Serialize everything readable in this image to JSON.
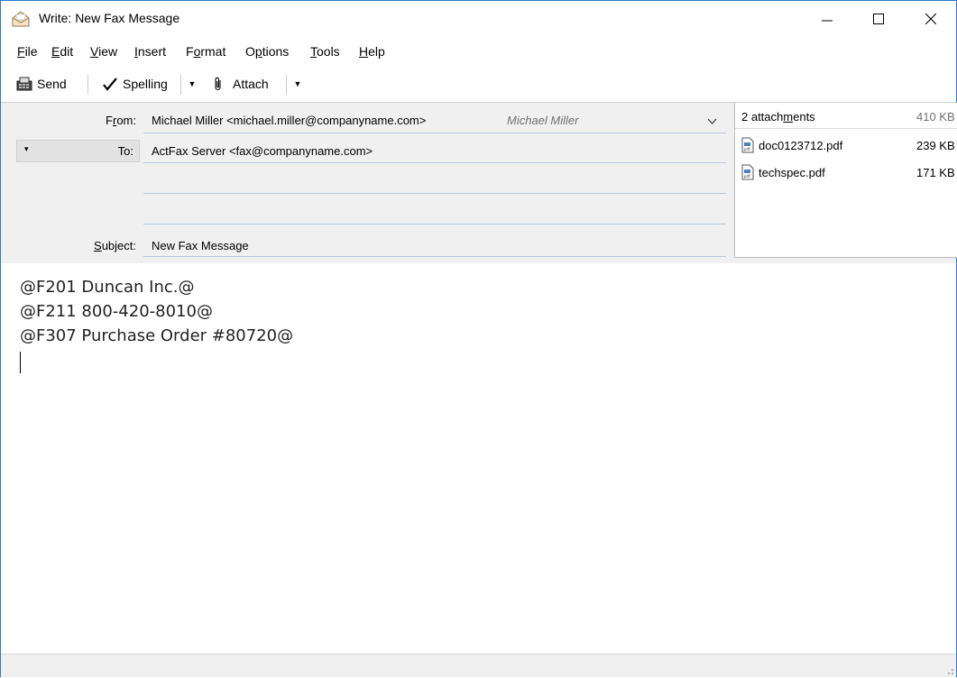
{
  "window": {
    "title": "Write: New Fax Message"
  },
  "menu": {
    "file": {
      "pre": "",
      "key": "F",
      "post": "ile"
    },
    "edit": {
      "pre": "",
      "key": "E",
      "post": "dit"
    },
    "view": {
      "pre": "",
      "key": "V",
      "post": "iew"
    },
    "insert": {
      "pre": "",
      "key": "I",
      "post": "nsert"
    },
    "format": {
      "pre": "F",
      "key": "o",
      "post": "rmat"
    },
    "options": {
      "pre": "O",
      "key": "p",
      "post": "tions"
    },
    "tools": {
      "pre": "",
      "key": "T",
      "post": "ools"
    },
    "help": {
      "pre": "",
      "key": "H",
      "post": "elp"
    }
  },
  "toolbar": {
    "send": "Send",
    "spelling": "Spelling",
    "attach": "Attach"
  },
  "header": {
    "from_label": {
      "pre": "F",
      "key": "r",
      "post": "om:"
    },
    "from_value": "Michael Miller <michael.miller@companyname.com>",
    "from_identity": "Michael Miller",
    "to_label": "To:",
    "to_value": "ActFax Server <fax@companyname.com>",
    "subject_label": {
      "pre": "",
      "key": "S",
      "post": "ubject:"
    },
    "subject_value": "New Fax Message"
  },
  "attachments": {
    "header": {
      "pre": "2 attach",
      "key": "m",
      "post": "ents"
    },
    "total_size": "410 KB",
    "items": [
      {
        "name": "doc0123712.pdf",
        "size": "239 KB"
      },
      {
        "name": "techspec.pdf",
        "size": "171 KB"
      }
    ]
  },
  "body": {
    "lines": [
      "@F201 Duncan Inc.@",
      "@F211 800-420-8010@",
      "@F307 Purchase Order #80720@"
    ]
  },
  "colors": {
    "window_border": "#2b7bd0",
    "header_bg": "#f0f0f0"
  }
}
